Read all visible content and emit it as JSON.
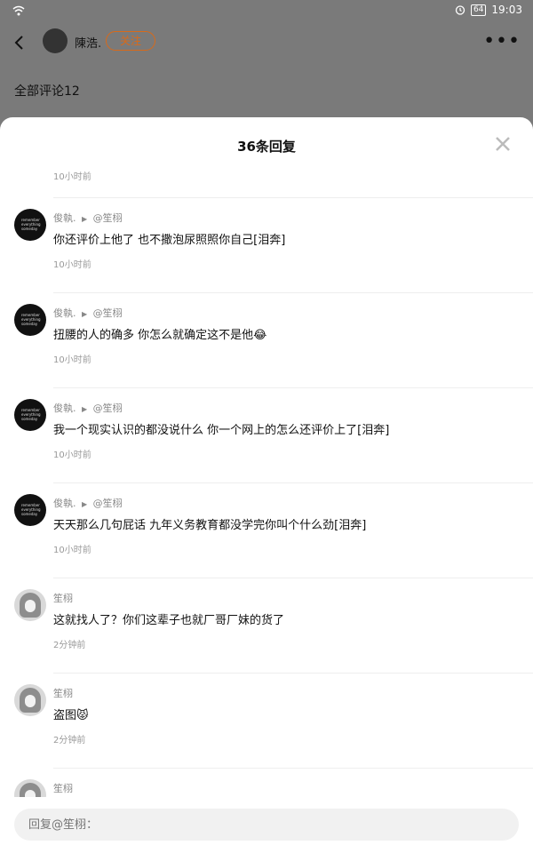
{
  "status": {
    "time": "19:03",
    "battery": "64"
  },
  "header": {
    "username": "陳浩.",
    "follow_label": "关注",
    "more_label": "•••"
  },
  "page": {
    "comment_count_label": "全部评论12"
  },
  "sheet": {
    "title": "36条回复",
    "top_time": "10小时前",
    "replies": [
      {
        "author": "俊執.",
        "arrow": "▶",
        "reply_to": "@笙栩",
        "text": "你还评价上他了 也不撒泡尿照照你自己[泪奔]",
        "time": "10小时前"
      },
      {
        "author": "俊執.",
        "arrow": "▶",
        "reply_to": "@笙栩",
        "text": "扭腰的人的确多 你怎么就确定这不是他😂",
        "time": "10小时前"
      },
      {
        "author": "俊執.",
        "arrow": "▶",
        "reply_to": "@笙栩",
        "text": "我一个现实认识的都没说什么 你一个网上的怎么还评价上了[泪奔]",
        "time": "10小时前"
      },
      {
        "author": "俊執.",
        "arrow": "▶",
        "reply_to": "@笙栩",
        "text": "天天那么几句屁话 九年义务教育都没学完你叫个什么劲[泪奔]",
        "time": "10小时前"
      },
      {
        "author": "笙栩",
        "arrow": "",
        "reply_to": "",
        "text": "这就找人了？你们这辈子也就厂哥厂妹的货了",
        "time": "2分钟前"
      },
      {
        "author": "笙栩",
        "arrow": "",
        "reply_to": "",
        "text": "盗图😾",
        "time": "2分钟前"
      },
      {
        "author": "笙栩",
        "arrow": "",
        "reply_to": "",
        "text": "",
        "time": ""
      }
    ],
    "reply_placeholder": "回复@笙栩："
  },
  "avatar_text": "remember everything someday"
}
